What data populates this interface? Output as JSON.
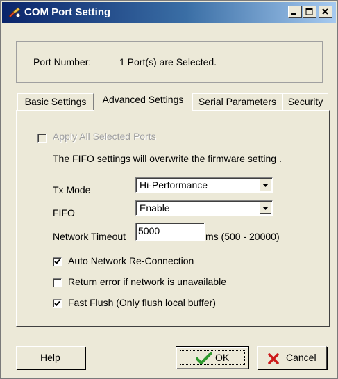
{
  "window": {
    "title": "COM Port Setting"
  },
  "port": {
    "label": "Port Number:",
    "value": "1 Port(s) are Selected."
  },
  "tabs": [
    {
      "label": "Basic Settings",
      "active": false
    },
    {
      "label": "Advanced Settings",
      "active": true
    },
    {
      "label": "Serial Parameters",
      "active": false
    },
    {
      "label": "Security",
      "active": false
    }
  ],
  "advanced": {
    "apply_all": {
      "label": "Apply All Selected Ports",
      "checked": false,
      "enabled": false
    },
    "fifo_note": "The FIFO settings will overwrite the firmware setting .",
    "tx_mode": {
      "label": "Tx Mode",
      "value": "Hi-Performance"
    },
    "fifo": {
      "label": "FIFO",
      "value": "Enable"
    },
    "network_timeout": {
      "label": "Network Timeout",
      "value": "5000",
      "range": "ms (500 - 20000)"
    },
    "auto_reconnect": {
      "label": "Auto Network Re-Connection",
      "checked": true
    },
    "return_error": {
      "label": "Return error if network is unavailable",
      "checked": false
    },
    "fast_flush": {
      "label": "Fast Flush (Only flush local buffer)",
      "checked": true
    }
  },
  "buttons": {
    "help_hotkey": "H",
    "help_rest": "elp",
    "ok": "OK",
    "cancel": "Cancel"
  },
  "icons": {
    "window": "port-settings-icon",
    "ok": "green-check-icon",
    "cancel": "red-x-icon"
  },
  "colors": {
    "titlebar_start": "#0a246a",
    "titlebar_end": "#a6caf0",
    "dialog_face": "#ece9d8",
    "ok_check": "#2e9a2e",
    "cancel_x": "#cc1a1a"
  }
}
